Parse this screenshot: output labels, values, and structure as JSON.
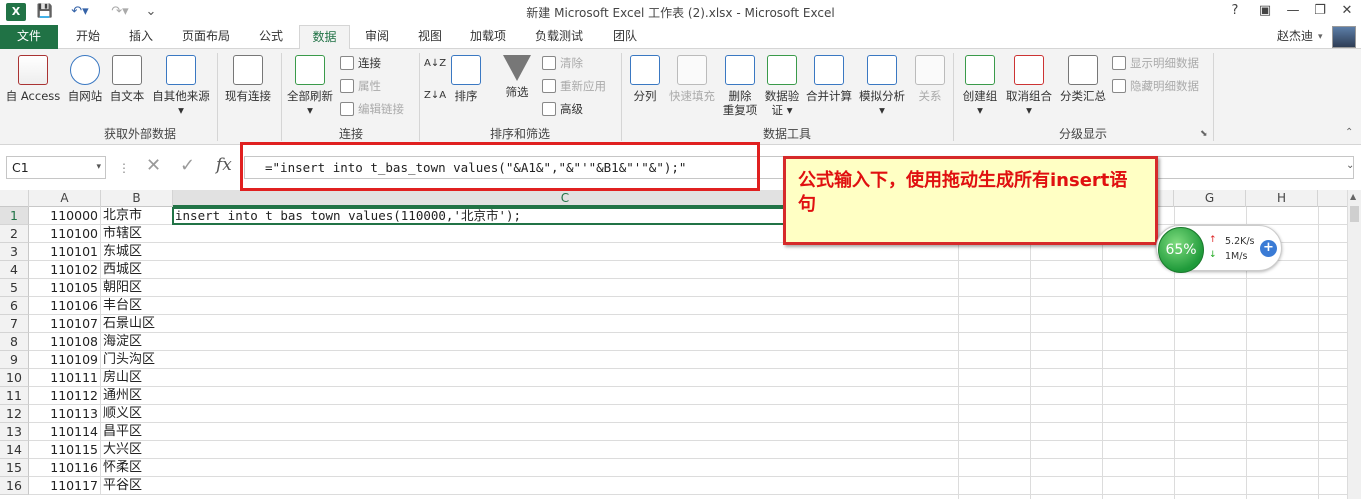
{
  "window": {
    "title": "新建 Microsoft Excel 工作表 (2).xlsx - Microsoft Excel",
    "user": "赵杰迪",
    "help": "?",
    "minimize": "—",
    "maximize": "❐",
    "close": "✕"
  },
  "tabs": [
    "文件",
    "开始",
    "插入",
    "页面布局",
    "公式",
    "数据",
    "审阅",
    "视图",
    "加载项",
    "负载测试",
    "团队"
  ],
  "ribbon": {
    "external": {
      "group": "获取外部数据",
      "access": "自 Access",
      "web": "自网站",
      "text": "自文本",
      "other": "自其他来源",
      "existing": "现有连接"
    },
    "connections": {
      "group": "连接",
      "refresh": "全部刷新",
      "conn": "连接",
      "props": "属性",
      "edit": "编辑链接"
    },
    "sort": {
      "group": "排序和筛选",
      "sort": "排序",
      "filter": "筛选",
      "clear": "清除",
      "reapply": "重新应用",
      "advanced": "高级"
    },
    "tools": {
      "group": "数据工具",
      "split": "分列",
      "flash": "快速填充",
      "dup1": "删除",
      "dup2": "重复项",
      "valid1": "数据验",
      "valid2": "证",
      "consol": "合并计算",
      "whatif": "模拟分析",
      "rel": "关系"
    },
    "outline": {
      "group": "分级显示",
      "group_btn": "创建组",
      "ungroup": "取消组合",
      "subtotal": "分类汇总",
      "show": "显示明细数据",
      "hide": "隐藏明细数据"
    }
  },
  "formula_bar": {
    "namebox": "C1",
    "fx": "fx",
    "formula": "=\"insert into t_bas_town values(\"&A1&\",\"&\"'\"&B1&\"'\"&\");\""
  },
  "columns": [
    "A",
    "B",
    "C",
    "G",
    "H"
  ],
  "rows": [
    {
      "n": "1",
      "a": "110000",
      "b": "北京市"
    },
    {
      "n": "2",
      "a": "110100",
      "b": "市辖区"
    },
    {
      "n": "3",
      "a": "110101",
      "b": "东城区"
    },
    {
      "n": "4",
      "a": "110102",
      "b": "西城区"
    },
    {
      "n": "5",
      "a": "110105",
      "b": "朝阳区"
    },
    {
      "n": "6",
      "a": "110106",
      "b": "丰台区"
    },
    {
      "n": "7",
      "a": "110107",
      "b": "石景山区"
    },
    {
      "n": "8",
      "a": "110108",
      "b": "海淀区"
    },
    {
      "n": "9",
      "a": "110109",
      "b": "门头沟区"
    },
    {
      "n": "10",
      "a": "110111",
      "b": "房山区"
    },
    {
      "n": "11",
      "a": "110112",
      "b": "通州区"
    },
    {
      "n": "12",
      "a": "110113",
      "b": "顺义区"
    },
    {
      "n": "13",
      "a": "110114",
      "b": "昌平区"
    },
    {
      "n": "14",
      "a": "110115",
      "b": "大兴区"
    },
    {
      "n": "15",
      "a": "110116",
      "b": "怀柔区"
    },
    {
      "n": "16",
      "a": "110117",
      "b": "平谷区"
    }
  ],
  "cell_c1": "insert into t bas town values(110000,'北京市');",
  "callout": "公式输入下，使用拖动生成所有insert语句",
  "speed": {
    "percent": "65%",
    "up": "5.2K/s",
    "down": "1M/s",
    "plus": "+"
  },
  "colors": {
    "excel_green": "#217346",
    "file_tab": "#207245",
    "callout_red": "#e01010",
    "callout_bg": "#ffffc4"
  }
}
